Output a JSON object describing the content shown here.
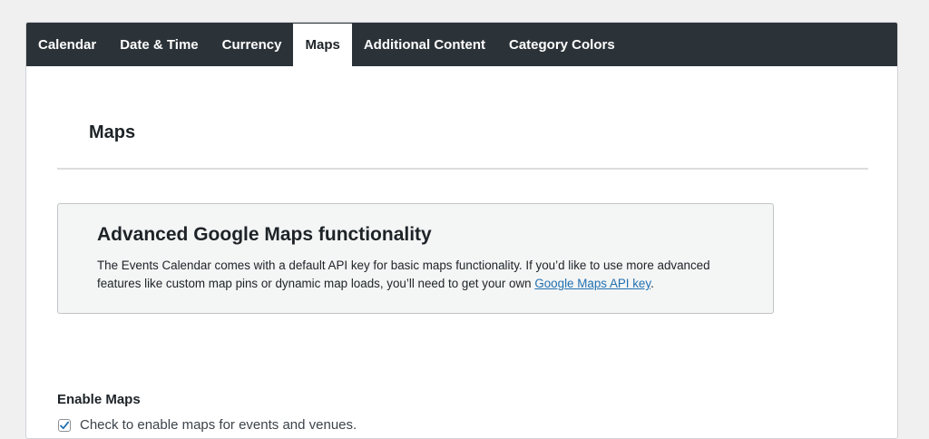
{
  "tabs": [
    {
      "label": "Calendar",
      "active": false
    },
    {
      "label": "Date & Time",
      "active": false
    },
    {
      "label": "Currency",
      "active": false
    },
    {
      "label": "Maps",
      "active": true
    },
    {
      "label": "Additional Content",
      "active": false
    },
    {
      "label": "Category Colors",
      "active": false
    }
  ],
  "section": {
    "title": "Maps"
  },
  "notice": {
    "heading": "Advanced Google Maps functionality",
    "body_before_link": "The Events Calendar comes with a default API key for basic maps functionality. If you’d like to use more advanced features like custom map pins or dynamic map loads, you’ll need to get your own ",
    "link_text": "Google Maps API key",
    "body_after_link": "."
  },
  "enable_maps": {
    "label": "Enable Maps",
    "checkbox_label": "Check to enable maps for events and venues.",
    "checked": true
  },
  "colors": {
    "tabbar": "#2c3338",
    "link": "#2271b1",
    "check": "#2271b1"
  }
}
